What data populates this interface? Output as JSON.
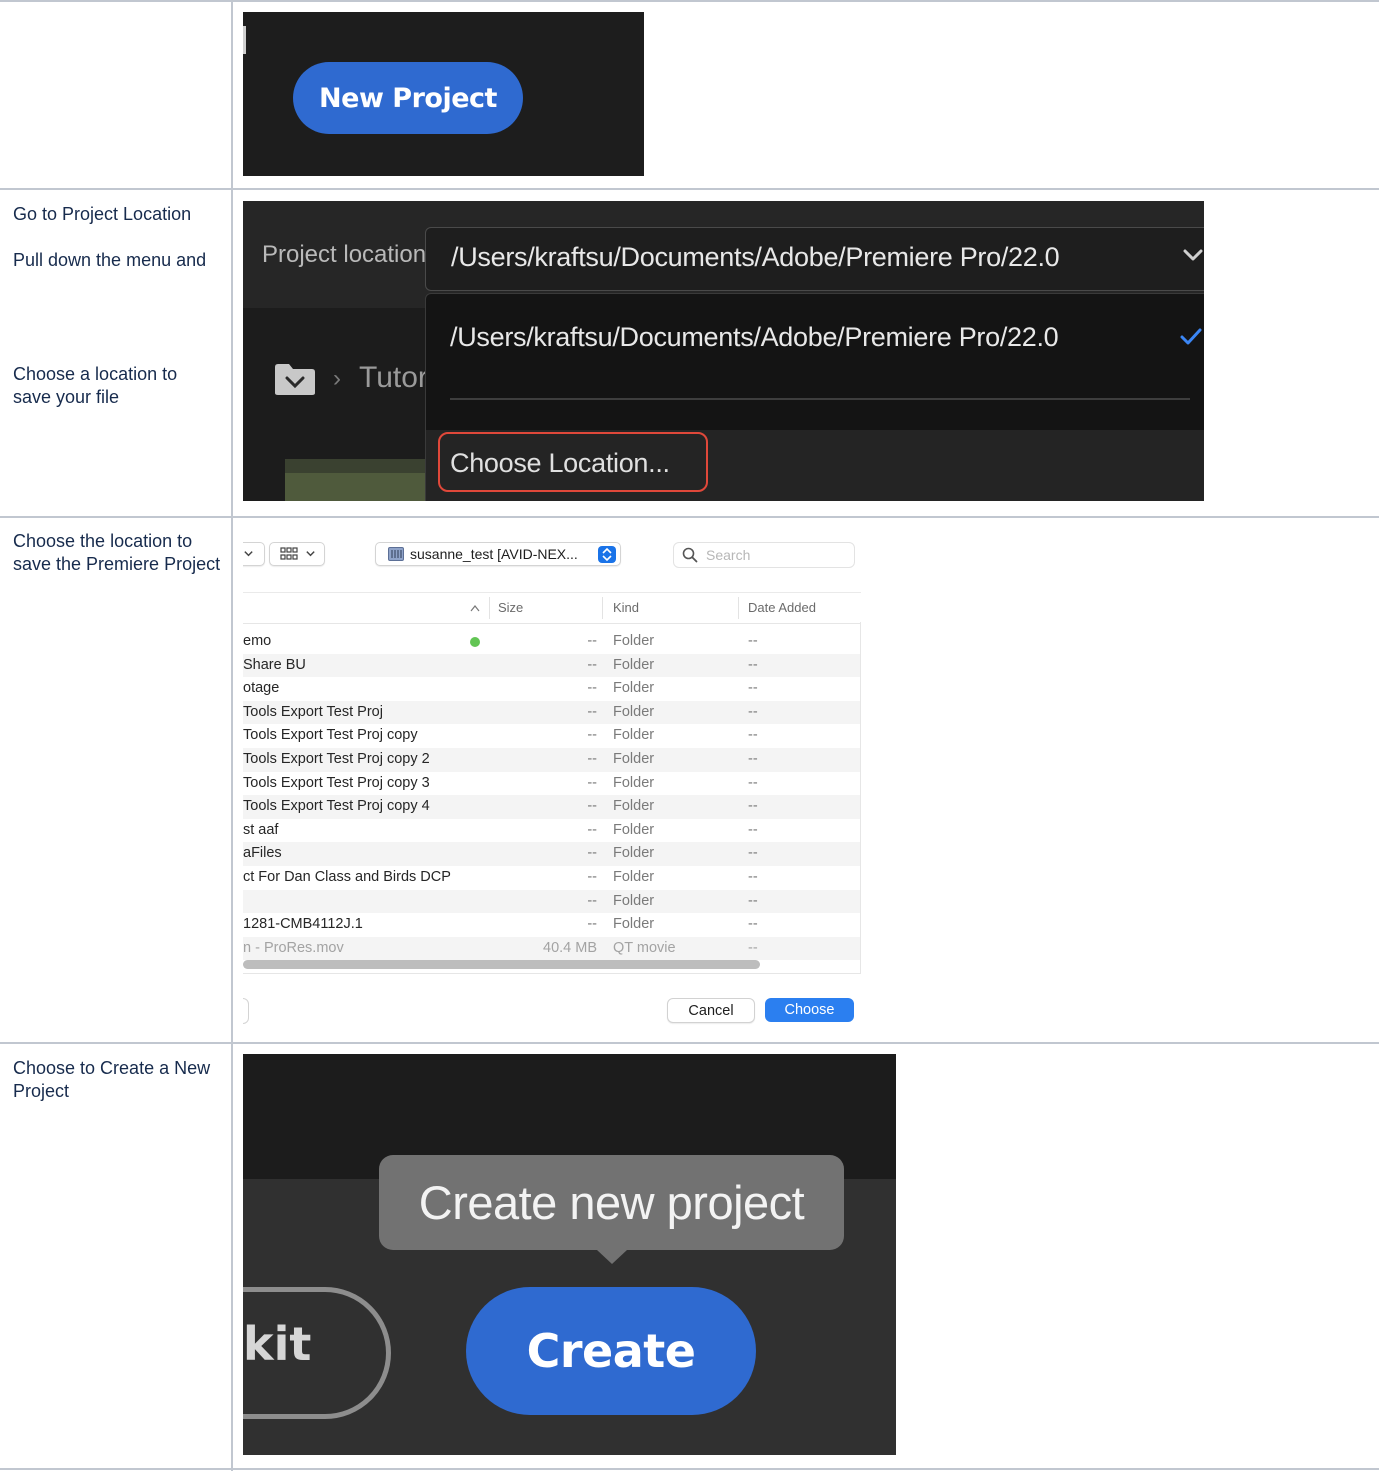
{
  "steps": [
    {
      "instructions": [],
      "screenshot": {
        "button_label": "New Project",
        "accent_color": "#2f6ad0"
      }
    },
    {
      "instructions": [
        "Go to Project Location",
        "Pull down the menu and",
        "Choose a location to save your file"
      ],
      "screenshot": {
        "field_label": "Project location",
        "selected_path": "/Users/kraftsu/Documents/Adobe/Premiere Pro/22.0",
        "menu_items": [
          "/Users/kraftsu/Documents/Adobe/Premiere Pro/22.0",
          "Choose Location..."
        ],
        "menu_selected_index": 0,
        "breadcrumb_text": "Tutor",
        "highlight_color": "#e0483a",
        "icons": [
          "chevron-down-icon",
          "checkmark-icon",
          "folder-icon"
        ]
      }
    },
    {
      "instructions": [
        "Choose the location to save the Premiere Project"
      ],
      "screenshot": {
        "volume_popup": "susanne_test [AVID-NEX...",
        "search_placeholder": "Search",
        "columns": [
          "Size",
          "Kind",
          "Date Added"
        ],
        "rows": [
          {
            "name": "emo",
            "size": "--",
            "kind": "Folder",
            "date": "--",
            "tag": "green"
          },
          {
            "name": "Share BU",
            "size": "--",
            "kind": "Folder",
            "date": "--"
          },
          {
            "name": "otage",
            "size": "--",
            "kind": "Folder",
            "date": "--"
          },
          {
            "name": "Tools Export Test Proj",
            "size": "--",
            "kind": "Folder",
            "date": "--"
          },
          {
            "name": "Tools Export Test Proj copy",
            "size": "--",
            "kind": "Folder",
            "date": "--"
          },
          {
            "name": "Tools Export Test Proj copy 2",
            "size": "--",
            "kind": "Folder",
            "date": "--"
          },
          {
            "name": "Tools Export Test Proj copy 3",
            "size": "--",
            "kind": "Folder",
            "date": "--"
          },
          {
            "name": "Tools Export Test Proj copy 4",
            "size": "--",
            "kind": "Folder",
            "date": "--"
          },
          {
            "name": "st aaf",
            "size": "--",
            "kind": "Folder",
            "date": "--"
          },
          {
            "name": "aFiles",
            "size": "--",
            "kind": "Folder",
            "date": "--"
          },
          {
            "name": "ct For Dan Class and Birds DCP",
            "size": "--",
            "kind": "Folder",
            "date": "--"
          },
          {
            "name": "",
            "size": "--",
            "kind": "Folder",
            "date": "--"
          },
          {
            "name": "1281-CMB4112J.1",
            "size": "--",
            "kind": "Folder",
            "date": "--"
          },
          {
            "name": "n - ProRes.mov",
            "size": "40.4 MB",
            "kind": "QT movie",
            "date": "--",
            "dimmed": true
          }
        ],
        "cancel_label": "Cancel",
        "choose_label": "Choose",
        "icons": [
          "chevron-down-icon",
          "grid-view-icon",
          "disk-icon",
          "stepper-icon",
          "search-icon",
          "sort-up-icon"
        ]
      }
    },
    {
      "instructions": [
        "Choose to Create a New Project"
      ],
      "screenshot": {
        "tooltip": "Create new project",
        "create_label": "Create",
        "exit_label_visible": "kit"
      }
    }
  ]
}
